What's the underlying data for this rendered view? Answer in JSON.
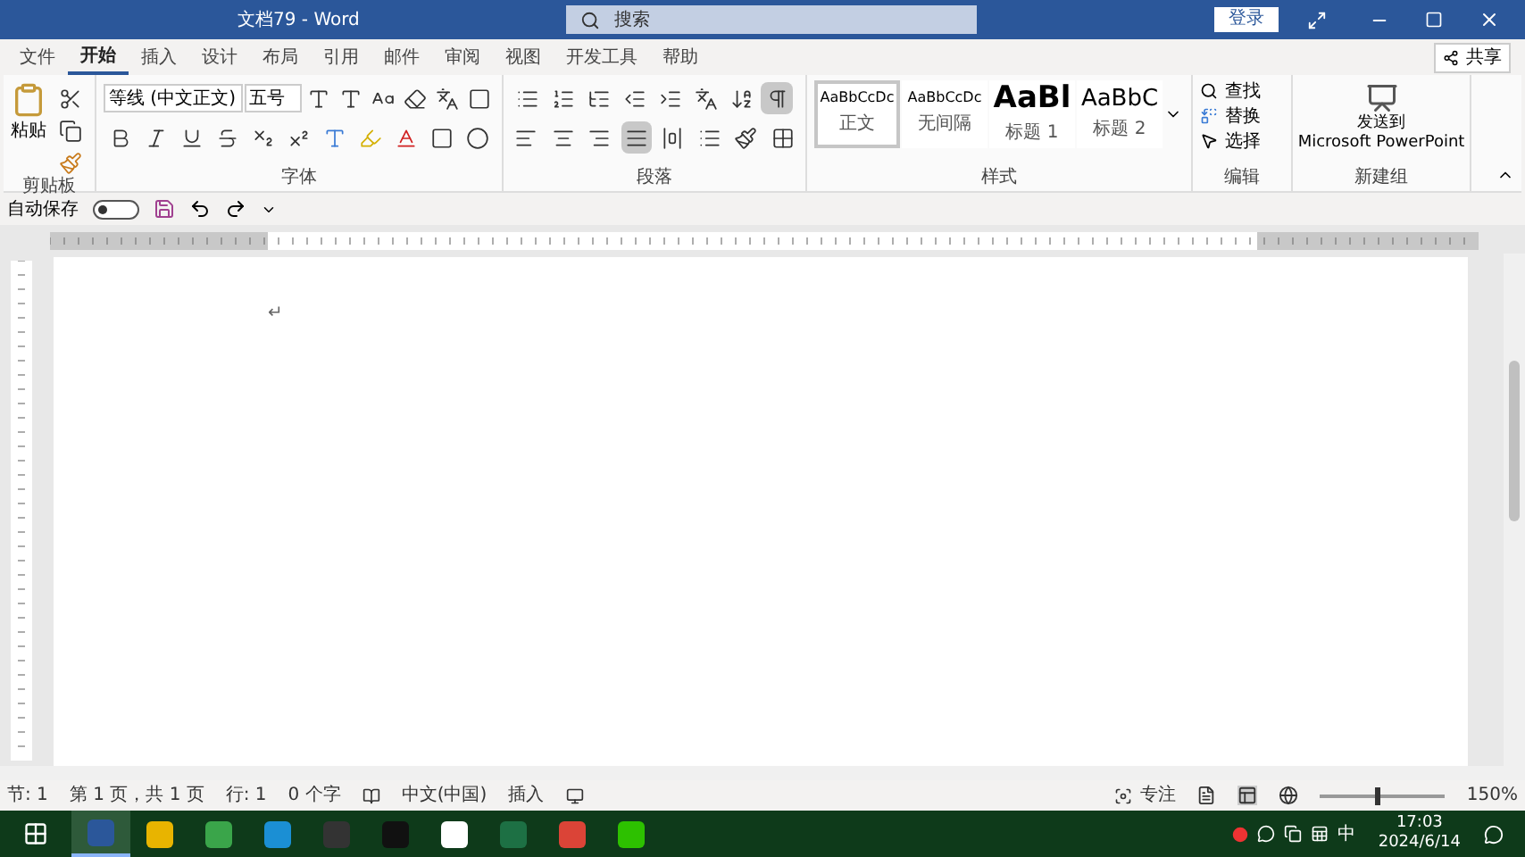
{
  "window": {
    "title": "文档79 - Word",
    "search_placeholder": "搜索",
    "sign_in": "登录"
  },
  "tabs": [
    {
      "label": "文件",
      "selected": false
    },
    {
      "label": "开始",
      "selected": true
    },
    {
      "label": "插入",
      "selected": false
    },
    {
      "label": "设计",
      "selected": false
    },
    {
      "label": "布局",
      "selected": false
    },
    {
      "label": "引用",
      "selected": false
    },
    {
      "label": "邮件",
      "selected": false
    },
    {
      "label": "审阅",
      "selected": false
    },
    {
      "label": "视图",
      "selected": false
    },
    {
      "label": "开发工具",
      "selected": false
    },
    {
      "label": "帮助",
      "selected": false
    }
  ],
  "share": "共享",
  "ribbon": {
    "clipboard": {
      "paste": "粘贴",
      "label": "剪贴板"
    },
    "font": {
      "name": "等线 (中文正文)",
      "size": "五号",
      "label": "字体"
    },
    "paragraph": {
      "label": "段落",
      "show_marks": true,
      "alignments": [
        {
          "kind": "left",
          "selected": false
        },
        {
          "kind": "center",
          "selected": false
        },
        {
          "kind": "right",
          "selected": false
        },
        {
          "kind": "justify",
          "selected": true
        },
        {
          "kind": "distributed",
          "selected": false
        }
      ]
    },
    "styles": {
      "label": "样式",
      "items": [
        {
          "sample": "AaBbCcDc",
          "name": "正文",
          "kind": "body",
          "selected": true
        },
        {
          "sample": "AaBbCcDc",
          "name": "无间隔",
          "kind": "body",
          "selected": false
        },
        {
          "sample": "AaBl",
          "name": "标题 1",
          "kind": "heading1",
          "selected": false
        },
        {
          "sample": "AaBbC",
          "name": "标题 2",
          "kind": "heading2",
          "selected": false
        }
      ]
    },
    "editing": {
      "label": "编辑",
      "find": "查找",
      "replace": "替换",
      "select": "选择"
    },
    "new_group": {
      "label": "新建组",
      "line1": "发送到",
      "line2": "Microsoft PowerPoint"
    }
  },
  "quick_access": {
    "autosave": "自动保存",
    "autosave_on": false
  },
  "document": {
    "paragraph_mark": "↵"
  },
  "status_bar": {
    "items": [
      "节: 1",
      "第 1 页，共 1 页",
      "行: 1",
      "0 个字"
    ],
    "language": "中文(中国)",
    "mode": "插入",
    "focus": "专注",
    "zoom": "150%",
    "zoom_slider": {
      "level": 0.43
    }
  },
  "taskbar": {
    "apps": [
      {
        "kind": "word",
        "selected": true
      },
      {
        "kind": "folder",
        "selected": false
      },
      {
        "kind": "green",
        "selected": false
      },
      {
        "kind": "edge",
        "selected": false
      },
      {
        "kind": "dark",
        "selected": false
      },
      {
        "kind": "cut",
        "selected": false
      },
      {
        "kind": "qq",
        "selected": false
      },
      {
        "kind": "excel",
        "selected": false
      },
      {
        "kind": "chrome",
        "selected": false
      },
      {
        "kind": "wechat",
        "selected": false
      }
    ],
    "ime": "中",
    "time": "17:03",
    "date": "2024/6/14"
  }
}
